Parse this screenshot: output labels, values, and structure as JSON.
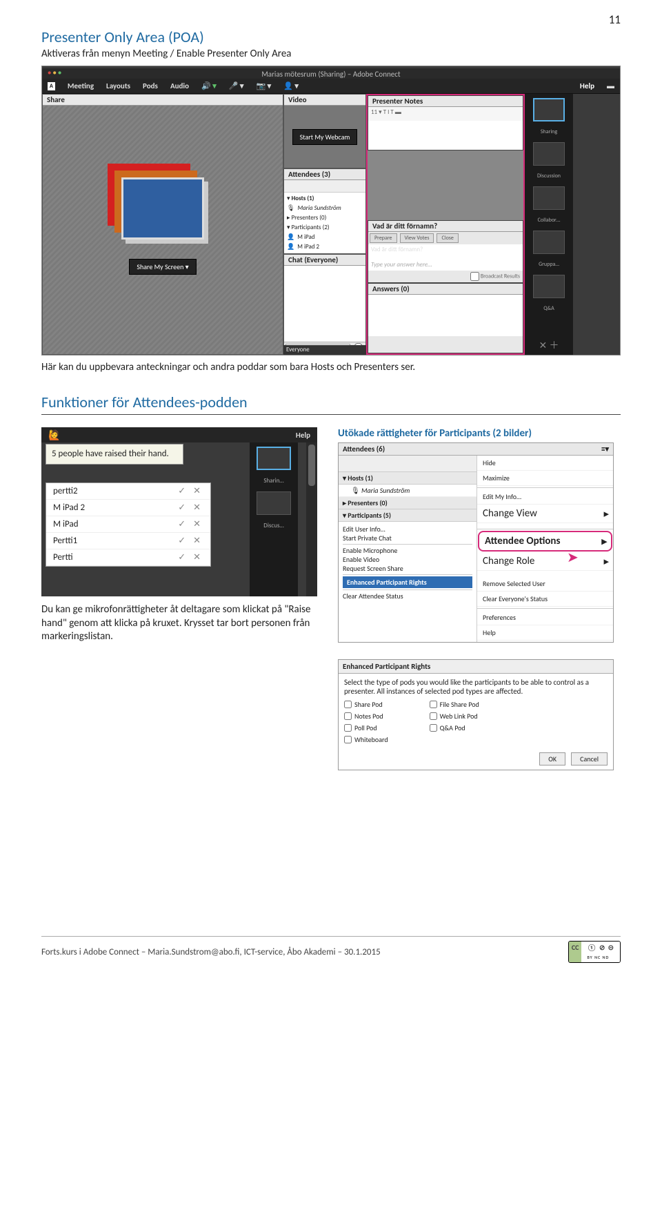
{
  "page": {
    "number": "11"
  },
  "heading": "Presenter Only Area (POA)",
  "sub": "Aktiveras från menyn Meeting / Enable Presenter Only Area",
  "shot1": {
    "title": "Marias mötesrum (Sharing) – Adobe Connect",
    "menu": {
      "meeting": "Meeting",
      "layouts": "Layouts",
      "pods": "Pods",
      "audio": "Audio",
      "help": "Help"
    },
    "share": {
      "head": "Share",
      "btn": "Share My Screen    ▾"
    },
    "video": {
      "head": "Video",
      "btn": "Start My Webcam"
    },
    "attendees": {
      "head": "Attendees   (3)",
      "hosts": "Hosts (1)",
      "host1": "Maria Sundström",
      "presenters": "Presenters (0)",
      "participants": "Participants (2)",
      "p1": "M iPad",
      "p2": "M iPad 2"
    },
    "chat": {
      "head": "Chat   (Everyone)"
    },
    "notes": {
      "head": "Presenter Notes",
      "tools": "11 ▾   T  I  T  ▬"
    },
    "poll": {
      "head": "Vad är ditt förnamn?",
      "prepare": "Prepare",
      "view": "View Votes",
      "close": "Close",
      "q": "Vad är ditt förnamn?",
      "ph": "Type your answer here…",
      "bc": "Broadcast Results"
    },
    "answers": {
      "head": "Answers (0)"
    },
    "everyone": "Everyone",
    "layouts": {
      "sharing": "Sharing",
      "discussion": "Discussion",
      "collab": "Collabor…",
      "gruppa": "Gruppa…",
      "qa": "Q&A"
    }
  },
  "caption": "Här kan du uppbevara anteckningar och andra poddar som bara Hosts och Presenters ser.",
  "sect": "Funktioner för Attendees-podden",
  "shot2": {
    "help": "Help",
    "tip": "5 people have raised their hand.",
    "rows": [
      "pertti2",
      "M iPad 2",
      "M iPad",
      "Pertti1",
      "Pertti"
    ],
    "side": {
      "sharing": "Sharin…",
      "discuss": "Discus…"
    }
  },
  "cap2": "Du kan ge mikrofonrättigheter åt deltagare som klickat på \"Raise hand\" genom att klicka på kruxet. Krysset tar bort personen från markeringslistan.",
  "bluehead": "Utökade rättigheter för Participants (2 bilder)",
  "shot3": {
    "head": "Attendees   (6)",
    "hosts": "Hosts (1)",
    "host1": "Maria Sundström",
    "presenters": "Presenters (0)",
    "participants": "Participants (5)",
    "left": [
      "Edit User Info…",
      "Start Private Chat",
      "Enable Microphone",
      "Enable Video",
      "Request Screen Share"
    ],
    "lefthi": "Enhanced Participant Rights",
    "leftlast": "Clear Attendee Status",
    "ctx": [
      "Hide",
      "Maximize",
      "Edit My Info…",
      "Change View",
      "Attendee Options",
      "Change Role",
      "Remove Selected User",
      "Clear Everyone's Status",
      "Preferences",
      "Help"
    ]
  },
  "shot4": {
    "head": "Enhanced Participant Rights",
    "desc": "Select the type of pods you would like the participants to be able to control as a presenter. All instances of selected pod types are affected.",
    "left": [
      "Share Pod",
      "Notes Pod",
      "Poll Pod",
      "Whiteboard"
    ],
    "right": [
      "File Share Pod",
      "Web Link Pod",
      "Q&A Pod"
    ],
    "ok": "OK",
    "cancel": "Cancel"
  },
  "footer": {
    "text": "Forts.kurs i Adobe Connect – Maria.Sundstrom@abo.fi, ICT-service, Åbo Akademi – 30.1.2015",
    "cc": "CC",
    "badges": "① ⊘ ⊝",
    "line": "BY NC ND"
  }
}
